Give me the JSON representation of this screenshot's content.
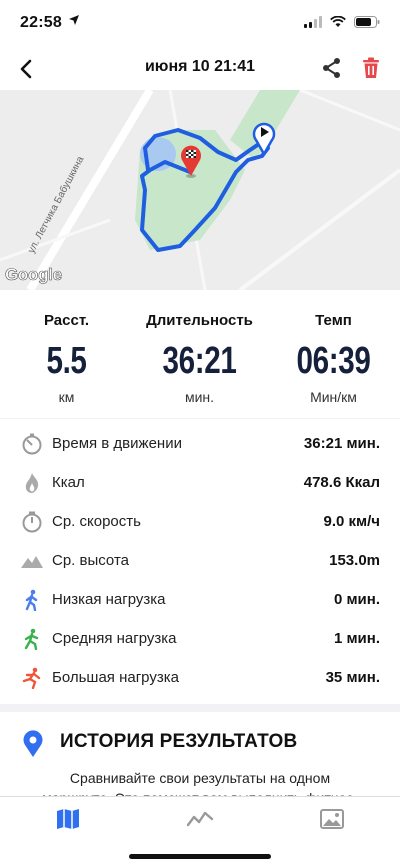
{
  "status_bar": {
    "time": "22:58"
  },
  "header": {
    "title": "июня 10  21:41"
  },
  "map": {
    "street_label": "ул. Летчика Бабушкина",
    "attribution": "Google",
    "route_color": "#1f5ee0"
  },
  "summary": [
    {
      "label": "Расст.",
      "value": "5.5",
      "unit": "км"
    },
    {
      "label": "Длительность",
      "value": "36:21",
      "unit": "мин."
    },
    {
      "label": "Темп",
      "value": "06:39",
      "unit": "Мин/км"
    }
  ],
  "details": [
    {
      "icon": "stopwatch-icon",
      "label": "Время в движении",
      "value": "36:21 мин."
    },
    {
      "icon": "flame-icon",
      "label": "Ккал",
      "value": "478.6 Ккал"
    },
    {
      "icon": "speedometer-icon",
      "label": "Ср. скорость",
      "value": "9.0 км/ч"
    },
    {
      "icon": "mountain-icon",
      "label": "Ср. высота",
      "value": "153.0m"
    },
    {
      "icon": "walking-blue-icon",
      "label": "Низкая нагрузка",
      "value": "0 мин."
    },
    {
      "icon": "walking-green-icon",
      "label": "Средняя нагрузка",
      "value": "1 мин."
    },
    {
      "icon": "running-red-icon",
      "label": "Большая нагрузка",
      "value": "35 мин."
    }
  ],
  "history": {
    "title": "ИСТОРИЯ РЕЗУЛЬТАТОВ",
    "description": "Сравнивайте свои результаты на одном маршруте. Это поможет вам выполнить фитнес-"
  },
  "colors": {
    "accent": "#2f6ff0",
    "trash": "#e5484d",
    "low": "#4a7df0",
    "mid": "#37b24d",
    "high": "#f0553a"
  }
}
